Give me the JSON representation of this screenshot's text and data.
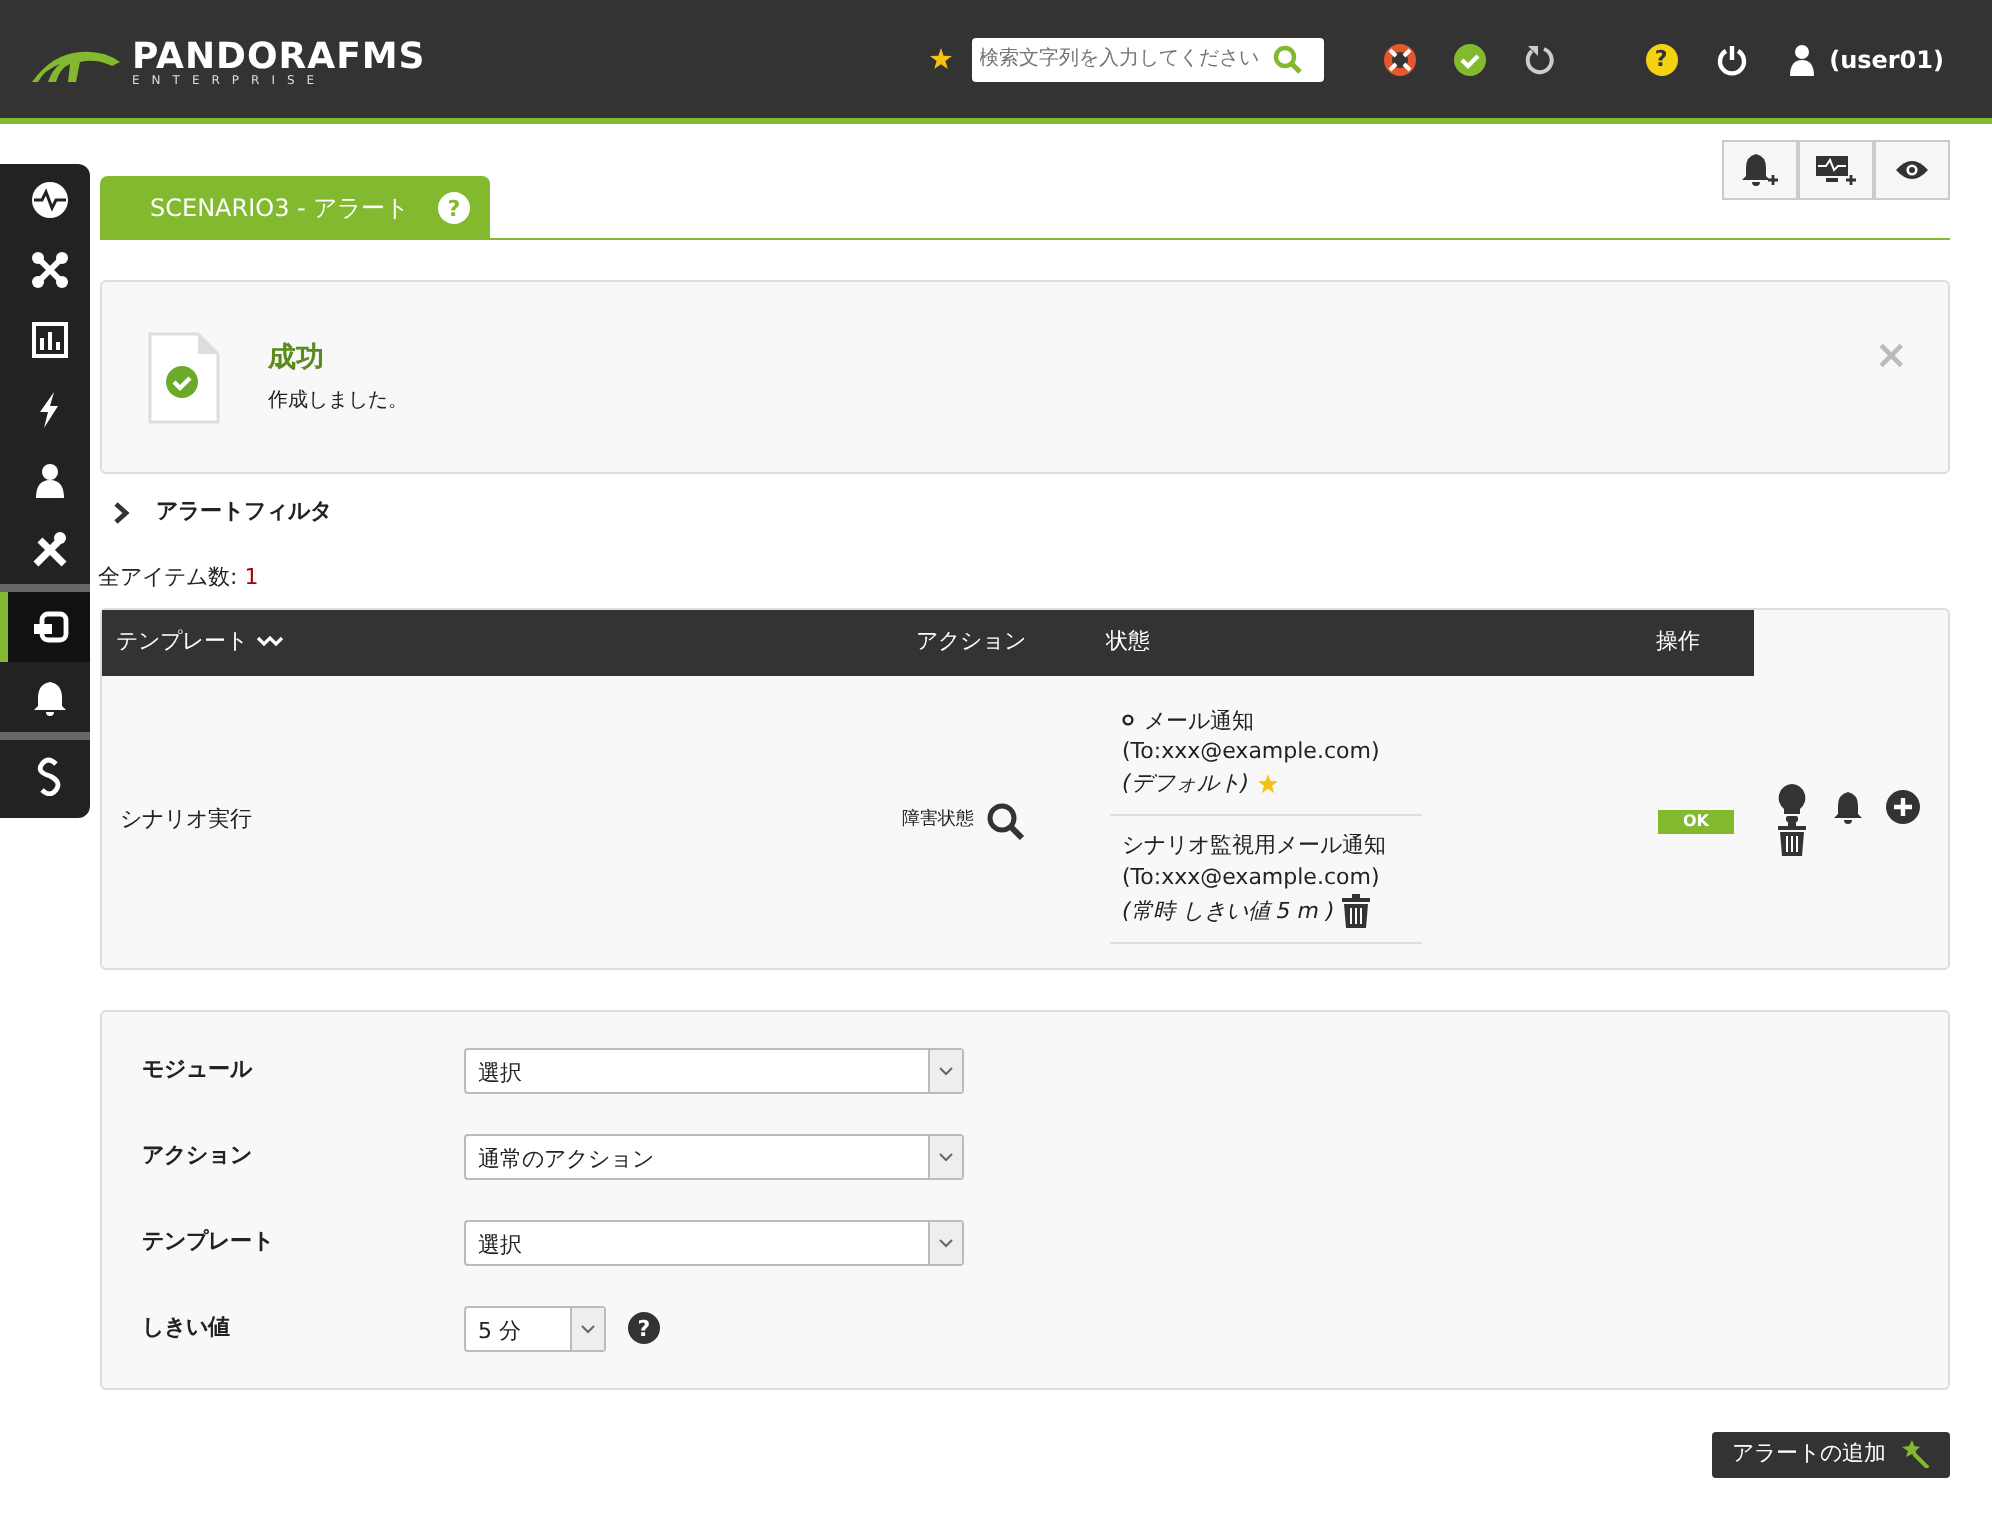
{
  "header": {
    "logo": "PANDORAFMS",
    "logo_sub": "ENTERPRISE",
    "search": {
      "placeholder": "検索文字列を入力してください"
    },
    "help": "?",
    "user": "(user01)"
  },
  "sidebar": {
    "items": [
      {
        "selected": false
      },
      {
        "selected": false
      },
      {
        "selected": false
      },
      {
        "selected": false
      },
      {
        "selected": false
      },
      {
        "selected": false
      },
      {
        "selected": true
      },
      {
        "selected": false
      },
      {
        "selected": false
      }
    ]
  },
  "tab": {
    "title": "SCENARIO3 - アラート",
    "help": "?"
  },
  "message": {
    "kind": "success",
    "title": "成功",
    "text": "作成しました。",
    "close": "×"
  },
  "filter": {
    "label": "アラートフィルタ",
    "expanded": false
  },
  "total": {
    "label": "全アイテム数:",
    "value": "1"
  },
  "table": {
    "columns": [
      "テンプレート",
      "アクション",
      "状態",
      "操作"
    ],
    "rows": [
      {
        "template": "シナリオ実行",
        "action": "障害状態",
        "status": "OK",
        "actions": [
          {
            "default": true,
            "name": "メール通知",
            "address": "(To:xxx@example.com)",
            "note": "(デフォルト)"
          },
          {
            "default": false,
            "name": "シナリオ監視用メール通知",
            "address": "(To:xxx@example.com)",
            "note": "(常時 しきい値 5 m )"
          }
        ]
      }
    ]
  },
  "form": {
    "fields": [
      {
        "kind": "wide",
        "label": "モジュール",
        "value": "選択"
      },
      {
        "kind": "wide",
        "label": "アクション",
        "value": "通常のアクション"
      },
      {
        "kind": "wide",
        "label": "テンプレート",
        "value": "選択"
      },
      {
        "kind": "short",
        "label": "しきい値",
        "value": "5 分",
        "help": "?"
      }
    ]
  },
  "add_button": "アラートの追加"
}
